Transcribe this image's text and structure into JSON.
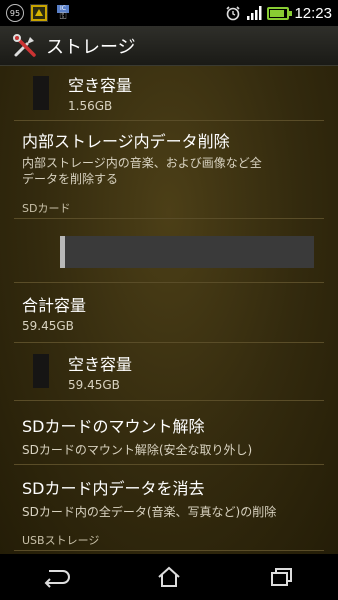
{
  "status_bar": {
    "notification_count": "95",
    "time": "12:23",
    "battery_level_percent": 90,
    "icons": [
      "notification-count-icon",
      "app-icon",
      "key-icon",
      "alarm-icon",
      "signal-icon",
      "battery-icon"
    ]
  },
  "action_bar": {
    "title": "ストレージ",
    "icon": "tools-icon"
  },
  "internal": {
    "free_label": "空き容量",
    "free_value": "1.56GB",
    "erase_title": "内部ストレージ内データ削除",
    "erase_desc_line1": "内部ストレージ内の音楽、および画像など全",
    "erase_desc_line2": "データを削除する"
  },
  "sd_card": {
    "section_label": "SDカード",
    "used_fraction": 0.02,
    "total_label": "合計容量",
    "total_value": "59.45GB",
    "free_label": "空き容量",
    "free_value": "59.45GB",
    "unmount_title": "SDカードのマウント解除",
    "unmount_desc": "SDカードのマウント解除(安全な取り外し)",
    "erase_title": "SDカード内データを消去",
    "erase_desc": "SDカード内の全データ(音楽、写真など)の削除"
  },
  "usb": {
    "section_label": "USBストレージ"
  },
  "colors": {
    "background": "#332a0e",
    "battery": "#88cc33",
    "usage_bar": "#3a3a3a"
  }
}
